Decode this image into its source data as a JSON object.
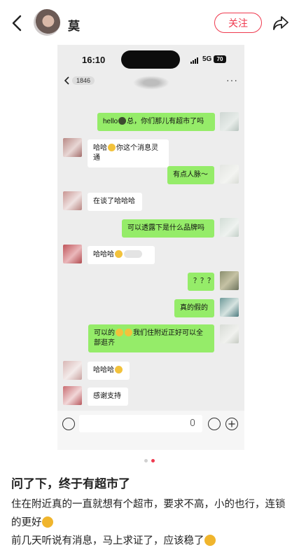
{
  "header": {
    "author": "莫",
    "follow_label": "关注"
  },
  "screenshot": {
    "status": {
      "time": "16:10",
      "network": "5G",
      "battery": "70"
    },
    "chat": {
      "unread": "1846",
      "more": "···"
    },
    "messages": [
      {
        "side": "me",
        "pre": "hello",
        "post": "总，你们那儿有超市了吗"
      },
      {
        "side": "them",
        "pre": "哈哈",
        "post": "你这个消息灵通"
      },
      {
        "side": "me",
        "pre": "有点人脉～",
        "post": ""
      },
      {
        "side": "them",
        "pre": "在谈了哈哈哈",
        "post": ""
      },
      {
        "side": "me",
        "pre": "可以透露下是什么品牌吗",
        "post": ""
      },
      {
        "side": "them",
        "pre": "哈哈哈",
        "post": ""
      },
      {
        "side": "me",
        "pre": "？？？",
        "post": ""
      },
      {
        "side": "me",
        "pre": "真的假的",
        "post": ""
      },
      {
        "side": "me",
        "pre": "可以的",
        "post": "我们住附近正好可以全部逛齐"
      },
      {
        "side": "them",
        "pre": "哈哈哈",
        "post": ""
      },
      {
        "side": "them",
        "pre": "感谢支持",
        "post": ""
      }
    ],
    "icons": [
      "voice-icon",
      "mic-icon",
      "emoji-icon",
      "plus-icon"
    ]
  },
  "post": {
    "title": "问了下，终于有超市了",
    "line1": "住在附近真的一直就想有个超市，要求不高，小的也行，连锁的更好",
    "line2": "前几天听说有消息，马上求证了，应该稳了"
  },
  "colors": {
    "accent": "#ef3a4f",
    "my_bubble": "#95ec69",
    "their_bubble": "#ffffff",
    "chat_bg": "#ededed"
  }
}
